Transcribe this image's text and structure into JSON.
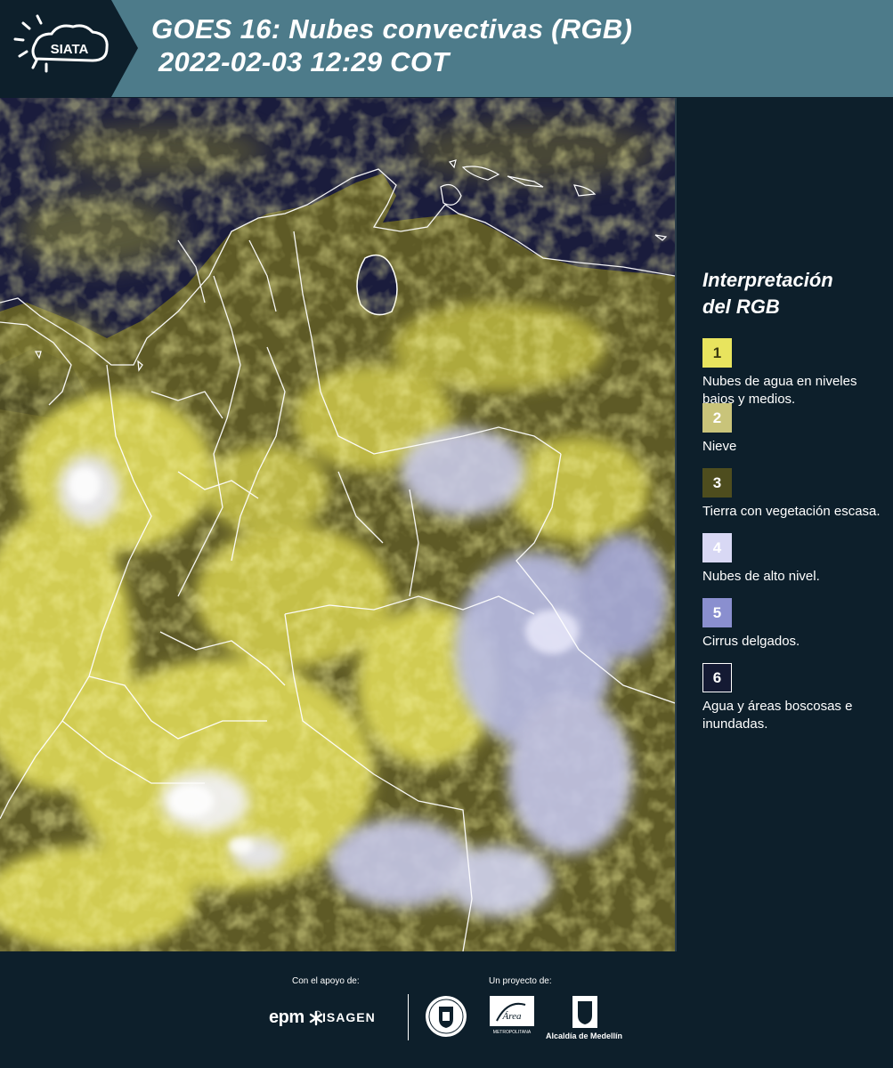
{
  "header": {
    "logo_text": "SIATA",
    "title_line1": "GOES 16: Nubes convectivas (RGB)",
    "title_line2": "2022-02-03 12:29 COT"
  },
  "legend": {
    "title_line1": "Interpretación",
    "title_line2": "del RGB",
    "items": [
      {
        "number": "1",
        "label": "Nubes de agua en niveles bajos y medios.",
        "color": "#e8e45e",
        "text_color": "#3b3a10"
      },
      {
        "number": "2",
        "label": "Nieve",
        "color": "#c9c47a",
        "text_color": "#ffffff"
      },
      {
        "number": "3",
        "label": "Tierra con vegetación escasa.",
        "color": "#4e4d1e",
        "text_color": "#ffffff"
      },
      {
        "number": "4",
        "label": "Nubes de alto nivel.",
        "color": "#d8d8f4",
        "text_color": "#ffffff"
      },
      {
        "number": "5",
        "label": "Cirrus delgados.",
        "color": "#8a8fcf",
        "text_color": "#ffffff"
      },
      {
        "number": "6",
        "label": "Agua y áreas boscosas e inundadas.",
        "color": "#141a33",
        "text_color": "#ffffff"
      }
    ]
  },
  "footer": {
    "support_label": "Con el apoyo de:",
    "project_label": "Un proyecto de:",
    "epm": "epm",
    "isagen": "ISAGEN",
    "area_text": "METROPOLITANA",
    "alcaldia": "Alcaldía de Medellín"
  },
  "colors": {
    "header_bg": "#4d7b8a",
    "page_bg": "#0d1f2b",
    "water": "#1a1c3c",
    "land": "#5e5a26",
    "low_cloud": "#e6e15a",
    "high_cloud": "#d6d6f2"
  }
}
